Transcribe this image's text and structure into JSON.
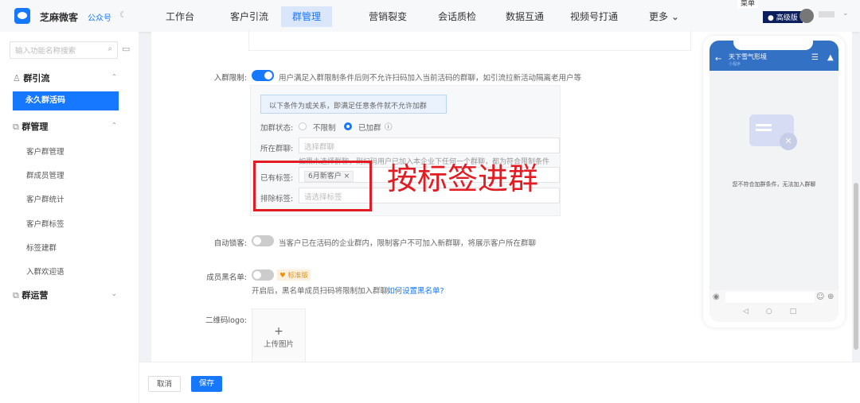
{
  "brand": {
    "name": "芝麻微客",
    "link": "公众号"
  },
  "tooltip": "菜单",
  "nav": [
    "工作台",
    "客户引流",
    "群管理",
    "营销裂变",
    "会话质检",
    "数据互通",
    "视频号打通",
    "更多 ⌄"
  ],
  "badge": "高级版",
  "sidebar": {
    "search_placeholder": "输入功能名称搜索",
    "groups": [
      {
        "label": "群引流",
        "items": [
          "永久群活码"
        ]
      },
      {
        "label": "群管理",
        "items": [
          "客户群管理",
          "群成员管理",
          "客户群统计",
          "客户群标签",
          "标签建群",
          "入群欢迎语"
        ]
      },
      {
        "label": "群运营",
        "items": []
      }
    ]
  },
  "form": {
    "join_limit": {
      "label": "入群限制:",
      "desc": "用户满足入群限制条件后则不允许扫码加入当前活码的群聊，如引流拉新活动隔离老用户等",
      "enabled": true
    },
    "note": "以下条件为或关系，即满足任意条件就不允许加群",
    "join_status": {
      "label": "加群状态:",
      "options": [
        "不限制",
        "已加群"
      ],
      "selected": "已加群"
    },
    "group": {
      "label": "所在群聊:",
      "placeholder": "选择群聊",
      "hint": "如果未选择群聊，则扫码用户已加入本企业下任何一个群聊，都为符合限制条件"
    },
    "has_tags": {
      "label": "已有标签:",
      "tags": [
        "6月新客户"
      ]
    },
    "exclude_tags": {
      "label": "排除标签:",
      "placeholder": "请选择标签"
    },
    "annotation": "按标签进群",
    "auto_lock": {
      "label": "自动锁客:",
      "desc": "当客户已在活码的企业群内，限制客户不可加入新群聊，将展示客户所在群聊",
      "enabled": false
    },
    "blacklist": {
      "label": "成员黑名单:",
      "badge": "标准版",
      "desc": "开启后，黑名单成员扫码将限制加入群聊",
      "link": "如何设置黑名单?",
      "enabled": false
    },
    "logo": {
      "label": "二维码logo:",
      "upload": "上传图片"
    }
  },
  "phone": {
    "title": "天下雪气形境",
    "subtitle": "小程序",
    "message": "您不符合加群条件，无法加入群聊"
  },
  "actions": {
    "cancel": "取消",
    "save": "保存"
  }
}
